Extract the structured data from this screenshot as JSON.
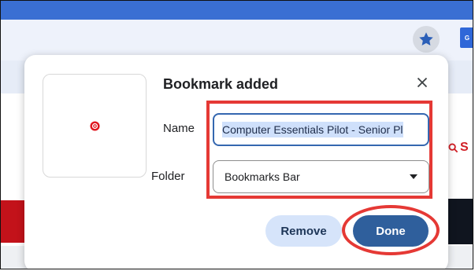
{
  "browser": {
    "star_icon": "star-icon",
    "google_tab_label": "G",
    "page_search_glyph": "S"
  },
  "dialog": {
    "title": "Bookmark added",
    "close_icon": "close-icon",
    "favicon_icon": "site-favicon",
    "name_label": "Name",
    "name_value": "Computer Essentials Pilot - Senior Pl",
    "folder_label": "Folder",
    "folder_value": "Bookmarks Bar",
    "remove_label": "Remove",
    "done_label": "Done"
  },
  "colors": {
    "highlight": "#e53935",
    "done_button": "#2f5f9c",
    "remove_button": "#d6e4fa",
    "input_focus": "#3467b0"
  }
}
